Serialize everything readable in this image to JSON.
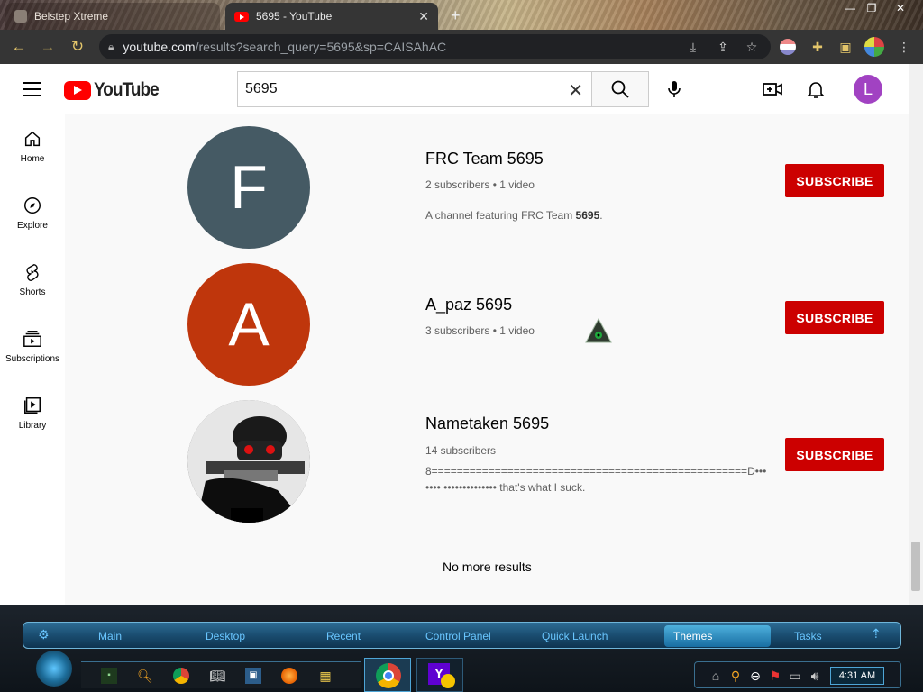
{
  "browser": {
    "tabs": [
      {
        "title": "Belstep Xtreme"
      },
      {
        "title": "5695 - YouTube"
      }
    ],
    "url_host": "youtube.com",
    "url_path": "/results?search_query=5695&sp=CAISAhAC"
  },
  "youtube": {
    "logo_text": "YouTube",
    "search_value": "5695",
    "avatar_letter": "L",
    "sidebar": [
      {
        "label": "Home",
        "icon": "home-icon"
      },
      {
        "label": "Explore",
        "icon": "compass-icon"
      },
      {
        "label": "Shorts",
        "icon": "shorts-icon"
      },
      {
        "label": "Subscriptions",
        "icon": "subscriptions-icon"
      },
      {
        "label": "Library",
        "icon": "library-icon"
      }
    ],
    "channels": [
      {
        "name": "FRC Team 5695",
        "meta": "2 subscribers • 1 video",
        "desc": "A channel featuring FRC Team ",
        "desc_bold": "5695",
        "desc_end": ".",
        "avatar_letter": "F",
        "avatar_color": "#455a64",
        "subscribe": "SUBSCRIBE"
      },
      {
        "name": "A_paz 5695",
        "meta": "3 subscribers • 1 video",
        "avatar_letter": "A",
        "avatar_color": "#bf360c",
        "subscribe": "SUBSCRIBE"
      },
      {
        "name": "Nametaken 5695",
        "meta": "14 subscribers",
        "desc": "8==================================================D••••••• •••••••••••••• that's what I suck.",
        "subscribe": "SUBSCRIBE"
      }
    ],
    "no_more": "No more results"
  },
  "taskbar": {
    "links": [
      "Main",
      "Desktop",
      "Recent",
      "Control Panel",
      "Quick Launch",
      "Themes",
      "Tasks"
    ],
    "clock": "4:31 AM"
  },
  "colors": {
    "subscribe_red": "#cc0000",
    "yt_red": "#ff0000",
    "avatar_purple": "#a142c2"
  }
}
